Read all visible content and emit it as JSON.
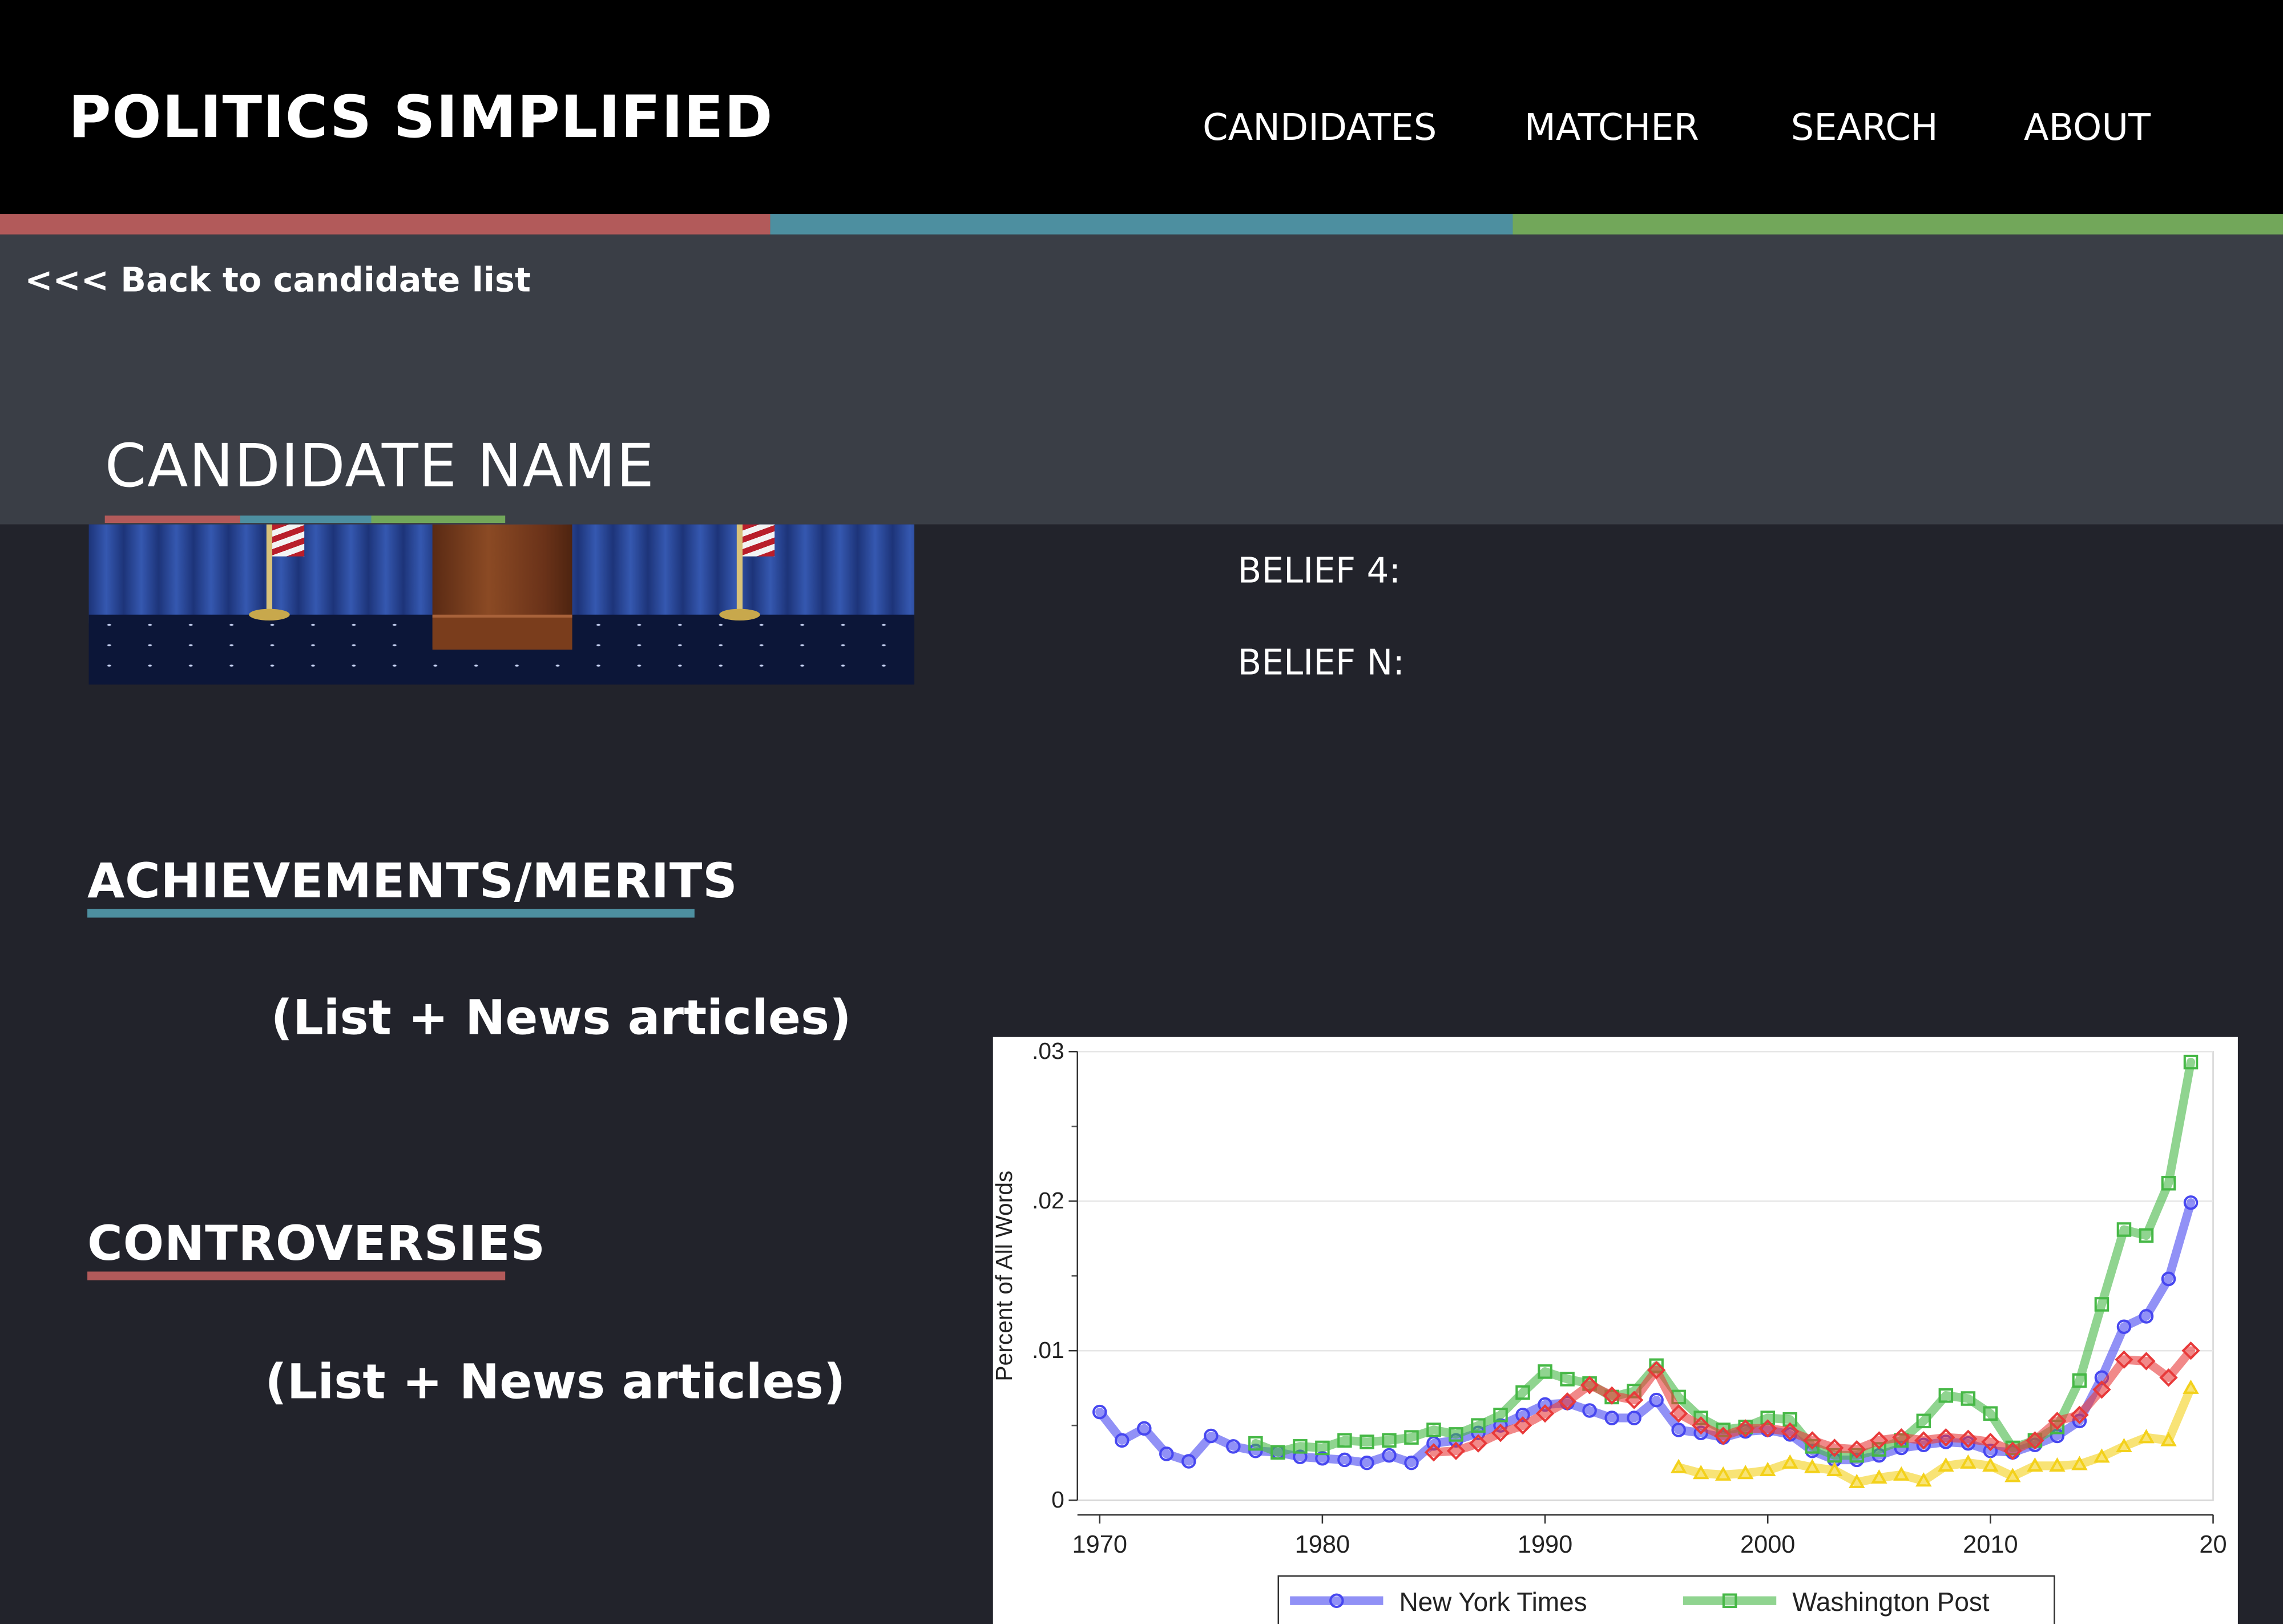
{
  "header": {
    "brand": "POLITICS SIMPLIFIED",
    "nav": [
      "CANDIDATES",
      "MATCHER",
      "SEARCH",
      "ABOUT"
    ]
  },
  "colors": {
    "red": "#b25a5a",
    "blue": "#4d8fa0",
    "green": "#72a75a"
  },
  "subheader": {
    "back_link": "<<< Back to candidate list",
    "candidate_name": "CANDIDATE NAME"
  },
  "beliefs": [
    "BELIEF 4:",
    "BELIEF N:"
  ],
  "sections": {
    "achievements": {
      "title": "ACHIEVEMENTS/MERITS",
      "body": "(List + News articles)"
    },
    "controversies": {
      "title": "CONTROVERSIES",
      "body": "(List + News articles)"
    }
  },
  "chart_data": {
    "type": "line",
    "ylabel": "Percent of All Words",
    "ylim": [
      0,
      0.03
    ],
    "yticks": [
      0,
      0.01,
      0.02,
      0.03
    ],
    "ytick_labels": [
      "0",
      ".01",
      ".02",
      ".03"
    ],
    "xlim": [
      1969,
      2020
    ],
    "xticks": [
      1970,
      1980,
      1990,
      2000,
      2010
    ],
    "xtick_labels": [
      "1970",
      "1980",
      "1990",
      "2000",
      "2010",
      "20"
    ],
    "grid": true,
    "legend_position": "bottom",
    "series": [
      {
        "name": "New York Times",
        "color": "#4747f0",
        "marker": "circle",
        "x": [
          1970,
          1971,
          1972,
          1973,
          1974,
          1975,
          1976,
          1977,
          1978,
          1979,
          1980,
          1981,
          1982,
          1983,
          1984,
          1985,
          1986,
          1987,
          1988,
          1989,
          1990,
          1991,
          1992,
          1993,
          1994,
          1995,
          1996,
          1997,
          1998,
          1999,
          2000,
          2001,
          2002,
          2003,
          2004,
          2005,
          2006,
          2007,
          2008,
          2009,
          2010,
          2011,
          2012,
          2013,
          2014,
          2015,
          2016,
          2017,
          2018,
          2019
        ],
        "y": [
          0.0059,
          0.004,
          0.0048,
          0.0031,
          0.0026,
          0.0043,
          0.0036,
          0.0033,
          0.0032,
          0.0029,
          0.0028,
          0.0027,
          0.0025,
          0.003,
          0.0025,
          0.0038,
          0.004,
          0.0045,
          0.005,
          0.0057,
          0.0064,
          0.0065,
          0.006,
          0.0055,
          0.0055,
          0.0067,
          0.0047,
          0.0045,
          0.0042,
          0.0046,
          0.0047,
          0.0044,
          0.0033,
          0.0027,
          0.0027,
          0.003,
          0.0035,
          0.0037,
          0.0039,
          0.0038,
          0.0033,
          0.0032,
          0.0037,
          0.0043,
          0.0053,
          0.0082,
          0.0116,
          0.0123,
          0.0148,
          0.0199
        ]
      },
      {
        "name": "Washington Post",
        "color": "#46b846",
        "marker": "square",
        "x": [
          1977,
          1978,
          1979,
          1980,
          1981,
          1982,
          1983,
          1984,
          1985,
          1986,
          1987,
          1988,
          1989,
          1990,
          1991,
          1992,
          1993,
          1994,
          1995,
          1996,
          1997,
          1998,
          1999,
          2000,
          2001,
          2002,
          2003,
          2004,
          2005,
          2006,
          2007,
          2008,
          2009,
          2010,
          2011,
          2012,
          2013,
          2014,
          2015,
          2016,
          2017,
          2018,
          2019
        ],
        "y": [
          0.0038,
          0.0032,
          0.0036,
          0.0035,
          0.004,
          0.0039,
          0.004,
          0.0042,
          0.0047,
          0.0044,
          0.005,
          0.0057,
          0.0072,
          0.0086,
          0.0081,
          0.0078,
          0.0069,
          0.0073,
          0.009,
          0.0069,
          0.0055,
          0.0047,
          0.0049,
          0.0055,
          0.0054,
          0.0036,
          0.003,
          0.003,
          0.0034,
          0.004,
          0.0053,
          0.007,
          0.0068,
          0.0058,
          0.0035,
          0.004,
          0.0049,
          0.008,
          0.0131,
          0.0181,
          0.0177,
          0.0212,
          0.0293
        ]
      },
      {
        "color": "#e83a3a",
        "marker": "diamond",
        "x": [
          1985,
          1986,
          1987,
          1988,
          1989,
          1990,
          1991,
          1992,
          1993,
          1994,
          1995,
          1996,
          1997,
          1998,
          1999,
          2000,
          2001,
          2002,
          2003,
          2004,
          2005,
          2006,
          2007,
          2008,
          2009,
          2010,
          2011,
          2012,
          2013,
          2014,
          2015,
          2016,
          2017,
          2018,
          2019
        ],
        "y": [
          0.0032,
          0.0033,
          0.0038,
          0.0045,
          0.005,
          0.0058,
          0.0066,
          0.0077,
          0.007,
          0.0067,
          0.0087,
          0.0058,
          0.005,
          0.0043,
          0.0048,
          0.0048,
          0.0046,
          0.004,
          0.0035,
          0.0034,
          0.004,
          0.0042,
          0.004,
          0.0042,
          0.0041,
          0.0039,
          0.0033,
          0.004,
          0.0053,
          0.0057,
          0.0074,
          0.0094,
          0.0093,
          0.0082,
          0.01
        ]
      },
      {
        "color": "#f3d11b",
        "marker": "triangle",
        "x": [
          1996,
          1997,
          1998,
          1999,
          2000,
          2001,
          2002,
          2003,
          2004,
          2005,
          2006,
          2007,
          2008,
          2009,
          2010,
          2011,
          2012,
          2013,
          2014,
          2015,
          2016,
          2017,
          2018,
          2019
        ],
        "y": [
          0.0022,
          0.0018,
          0.0017,
          0.0018,
          0.002,
          0.0025,
          0.0022,
          0.002,
          0.0012,
          0.0015,
          0.0017,
          0.0013,
          0.0023,
          0.0025,
          0.0023,
          0.0016,
          0.0023,
          0.0023,
          0.0024,
          0.0029,
          0.0036,
          0.0042,
          0.004,
          0.0075
        ]
      }
    ]
  }
}
